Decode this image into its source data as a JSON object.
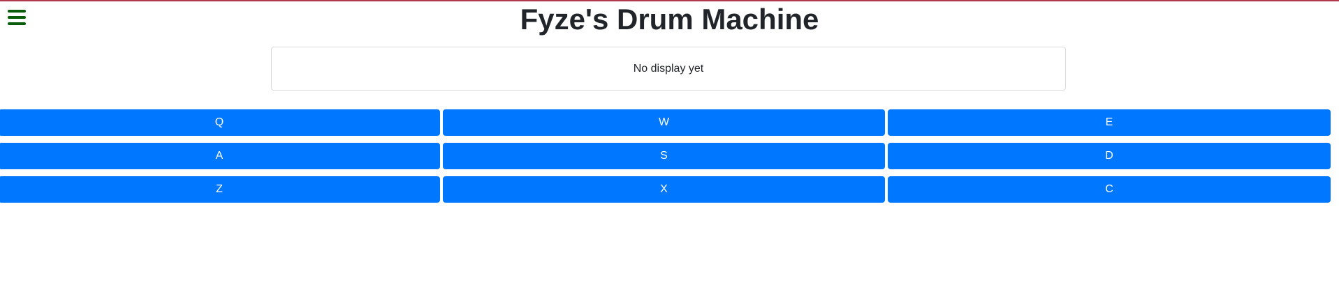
{
  "header": {
    "title": "Fyze's Drum Machine",
    "menu_icon": "hamburger-menu-icon",
    "menu_icon_color": "#0a5c0a",
    "top_border_color": "#b0384f"
  },
  "display": {
    "text": "No display yet"
  },
  "pads": {
    "color": "#0077ff",
    "keys": [
      {
        "label": "Q"
      },
      {
        "label": "W"
      },
      {
        "label": "E"
      },
      {
        "label": "A"
      },
      {
        "label": "S"
      },
      {
        "label": "D"
      },
      {
        "label": "Z"
      },
      {
        "label": "X"
      },
      {
        "label": "C"
      }
    ]
  }
}
